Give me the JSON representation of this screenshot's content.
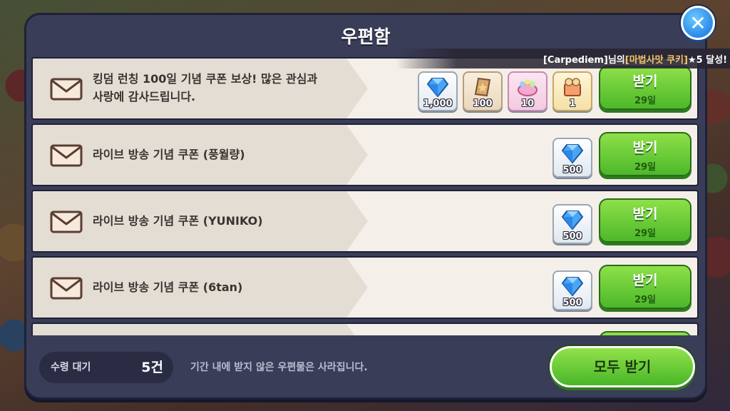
{
  "panel": {
    "title": "우편함"
  },
  "banner": {
    "prefix": "[Carpediem]님의 ",
    "highlight": "[마법사맛 쿠키]",
    "suffix": " ★5 달성!"
  },
  "mails": [
    {
      "title": "킹덤 런칭 100일 기념 쿠폰 보상!  많은 관심과\n사랑에 감사드립니다.",
      "rewards": [
        {
          "icon": "crystal-icon",
          "qty": "1,000"
        },
        {
          "icon": "soulstone-icon",
          "qty": "100"
        },
        {
          "icon": "cake-icon",
          "qty": "10"
        },
        {
          "icon": "cookie-box-icon",
          "qty": "1"
        }
      ],
      "claim_label": "받기",
      "days": "29일"
    },
    {
      "title": "라이브 방송 기념 쿠폰 (풍월량)",
      "rewards": [
        {
          "icon": "crystal-icon",
          "qty": "500"
        }
      ],
      "claim_label": "받기",
      "days": "29일"
    },
    {
      "title": "라이브 방송 기념 쿠폰 (YUNIKO)",
      "rewards": [
        {
          "icon": "crystal-icon",
          "qty": "500"
        }
      ],
      "claim_label": "받기",
      "days": "29일"
    },
    {
      "title": "라이브 방송 기념 쿠폰 (6tan)",
      "rewards": [
        {
          "icon": "crystal-icon",
          "qty": "500"
        }
      ],
      "claim_label": "받기",
      "days": "29일"
    }
  ],
  "footer": {
    "pending_label": "수령 대기",
    "pending_count": "5건",
    "expiry_note": "기간 내에 받지 않은 우편물은 사라집니다.",
    "claim_all_label": "모두 받기"
  },
  "colors": {
    "claim_green": "#4cb82a",
    "panel": "#3a3d58",
    "crystal_blue": "#2e86e8"
  }
}
